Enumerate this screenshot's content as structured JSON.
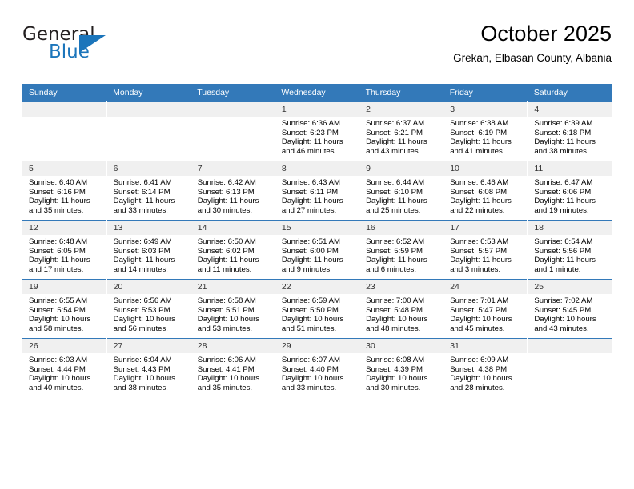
{
  "brand": {
    "name_part1": "General",
    "name_part2": "Blue",
    "accent_color": "#1b75bb"
  },
  "header": {
    "title": "October 2025",
    "subtitle": "Grekan, Elbasan County, Albania"
  },
  "calendar": {
    "header_color": "#3379b9",
    "daynum_band_color": "#f0f0f0",
    "weekday_headers": [
      "Sunday",
      "Monday",
      "Tuesday",
      "Wednesday",
      "Thursday",
      "Friday",
      "Saturday"
    ],
    "labels": {
      "sunrise": "Sunrise:",
      "sunset": "Sunset:",
      "daylight": "Daylight:"
    },
    "weeks": [
      [
        {
          "day": "",
          "lines": []
        },
        {
          "day": "",
          "lines": []
        },
        {
          "day": "",
          "lines": []
        },
        {
          "day": "1",
          "lines": [
            "Sunrise: 6:36 AM",
            "Sunset: 6:23 PM",
            "Daylight: 11 hours",
            "and 46 minutes."
          ]
        },
        {
          "day": "2",
          "lines": [
            "Sunrise: 6:37 AM",
            "Sunset: 6:21 PM",
            "Daylight: 11 hours",
            "and 43 minutes."
          ]
        },
        {
          "day": "3",
          "lines": [
            "Sunrise: 6:38 AM",
            "Sunset: 6:19 PM",
            "Daylight: 11 hours",
            "and 41 minutes."
          ]
        },
        {
          "day": "4",
          "lines": [
            "Sunrise: 6:39 AM",
            "Sunset: 6:18 PM",
            "Daylight: 11 hours",
            "and 38 minutes."
          ]
        }
      ],
      [
        {
          "day": "5",
          "lines": [
            "Sunrise: 6:40 AM",
            "Sunset: 6:16 PM",
            "Daylight: 11 hours",
            "and 35 minutes."
          ]
        },
        {
          "day": "6",
          "lines": [
            "Sunrise: 6:41 AM",
            "Sunset: 6:14 PM",
            "Daylight: 11 hours",
            "and 33 minutes."
          ]
        },
        {
          "day": "7",
          "lines": [
            "Sunrise: 6:42 AM",
            "Sunset: 6:13 PM",
            "Daylight: 11 hours",
            "and 30 minutes."
          ]
        },
        {
          "day": "8",
          "lines": [
            "Sunrise: 6:43 AM",
            "Sunset: 6:11 PM",
            "Daylight: 11 hours",
            "and 27 minutes."
          ]
        },
        {
          "day": "9",
          "lines": [
            "Sunrise: 6:44 AM",
            "Sunset: 6:10 PM",
            "Daylight: 11 hours",
            "and 25 minutes."
          ]
        },
        {
          "day": "10",
          "lines": [
            "Sunrise: 6:46 AM",
            "Sunset: 6:08 PM",
            "Daylight: 11 hours",
            "and 22 minutes."
          ]
        },
        {
          "day": "11",
          "lines": [
            "Sunrise: 6:47 AM",
            "Sunset: 6:06 PM",
            "Daylight: 11 hours",
            "and 19 minutes."
          ]
        }
      ],
      [
        {
          "day": "12",
          "lines": [
            "Sunrise: 6:48 AM",
            "Sunset: 6:05 PM",
            "Daylight: 11 hours",
            "and 17 minutes."
          ]
        },
        {
          "day": "13",
          "lines": [
            "Sunrise: 6:49 AM",
            "Sunset: 6:03 PM",
            "Daylight: 11 hours",
            "and 14 minutes."
          ]
        },
        {
          "day": "14",
          "lines": [
            "Sunrise: 6:50 AM",
            "Sunset: 6:02 PM",
            "Daylight: 11 hours",
            "and 11 minutes."
          ]
        },
        {
          "day": "15",
          "lines": [
            "Sunrise: 6:51 AM",
            "Sunset: 6:00 PM",
            "Daylight: 11 hours",
            "and 9 minutes."
          ]
        },
        {
          "day": "16",
          "lines": [
            "Sunrise: 6:52 AM",
            "Sunset: 5:59 PM",
            "Daylight: 11 hours",
            "and 6 minutes."
          ]
        },
        {
          "day": "17",
          "lines": [
            "Sunrise: 6:53 AM",
            "Sunset: 5:57 PM",
            "Daylight: 11 hours",
            "and 3 minutes."
          ]
        },
        {
          "day": "18",
          "lines": [
            "Sunrise: 6:54 AM",
            "Sunset: 5:56 PM",
            "Daylight: 11 hours",
            "and 1 minute."
          ]
        }
      ],
      [
        {
          "day": "19",
          "lines": [
            "Sunrise: 6:55 AM",
            "Sunset: 5:54 PM",
            "Daylight: 10 hours",
            "and 58 minutes."
          ]
        },
        {
          "day": "20",
          "lines": [
            "Sunrise: 6:56 AM",
            "Sunset: 5:53 PM",
            "Daylight: 10 hours",
            "and 56 minutes."
          ]
        },
        {
          "day": "21",
          "lines": [
            "Sunrise: 6:58 AM",
            "Sunset: 5:51 PM",
            "Daylight: 10 hours",
            "and 53 minutes."
          ]
        },
        {
          "day": "22",
          "lines": [
            "Sunrise: 6:59 AM",
            "Sunset: 5:50 PM",
            "Daylight: 10 hours",
            "and 51 minutes."
          ]
        },
        {
          "day": "23",
          "lines": [
            "Sunrise: 7:00 AM",
            "Sunset: 5:48 PM",
            "Daylight: 10 hours",
            "and 48 minutes."
          ]
        },
        {
          "day": "24",
          "lines": [
            "Sunrise: 7:01 AM",
            "Sunset: 5:47 PM",
            "Daylight: 10 hours",
            "and 45 minutes."
          ]
        },
        {
          "day": "25",
          "lines": [
            "Sunrise: 7:02 AM",
            "Sunset: 5:45 PM",
            "Daylight: 10 hours",
            "and 43 minutes."
          ]
        }
      ],
      [
        {
          "day": "26",
          "lines": [
            "Sunrise: 6:03 AM",
            "Sunset: 4:44 PM",
            "Daylight: 10 hours",
            "and 40 minutes."
          ]
        },
        {
          "day": "27",
          "lines": [
            "Sunrise: 6:04 AM",
            "Sunset: 4:43 PM",
            "Daylight: 10 hours",
            "and 38 minutes."
          ]
        },
        {
          "day": "28",
          "lines": [
            "Sunrise: 6:06 AM",
            "Sunset: 4:41 PM",
            "Daylight: 10 hours",
            "and 35 minutes."
          ]
        },
        {
          "day": "29",
          "lines": [
            "Sunrise: 6:07 AM",
            "Sunset: 4:40 PM",
            "Daylight: 10 hours",
            "and 33 minutes."
          ]
        },
        {
          "day": "30",
          "lines": [
            "Sunrise: 6:08 AM",
            "Sunset: 4:39 PM",
            "Daylight: 10 hours",
            "and 30 minutes."
          ]
        },
        {
          "day": "31",
          "lines": [
            "Sunrise: 6:09 AM",
            "Sunset: 4:38 PM",
            "Daylight: 10 hours",
            "and 28 minutes."
          ]
        },
        {
          "day": "",
          "lines": []
        }
      ]
    ]
  }
}
